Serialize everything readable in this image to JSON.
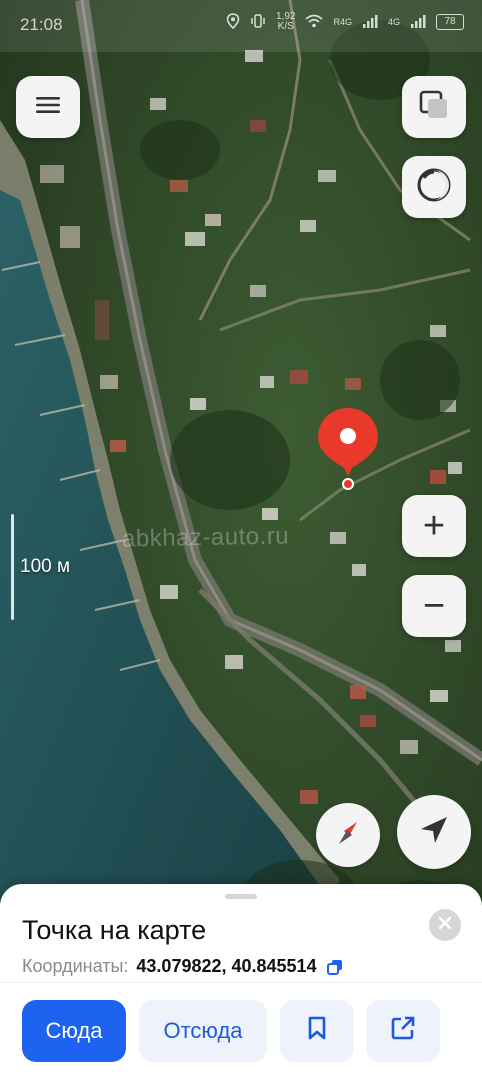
{
  "status_bar": {
    "time": "21:08",
    "net_speed_top": "1,92",
    "net_speed_bottom": "K/S",
    "signal_1": "R4G",
    "signal_2": "4G",
    "battery": "78"
  },
  "map": {
    "scale_label": "100 м",
    "watermark": "abkhaz-auto.ru",
    "colors": {
      "sea": "#1d4a4f",
      "land": "#2f4a2a",
      "pin": "#e8392b"
    }
  },
  "buttons": {
    "menu_icon": "hamburger-icon",
    "layers_icon": "layers-icon",
    "night_icon": "night-mode-icon",
    "zoom_in": "+",
    "zoom_out": "−",
    "compass_icon": "compass-icon",
    "locate_icon": "navigation-arrow-icon"
  },
  "sheet": {
    "title": "Точка на карте",
    "coords_label": "Координаты:",
    "coords_value": "43.079822, 40.845514",
    "btn_here": "Сюда",
    "btn_from": "Отсюда",
    "colors": {
      "primary": "#1e63f0",
      "secondary_bg": "#edf2fb"
    }
  }
}
